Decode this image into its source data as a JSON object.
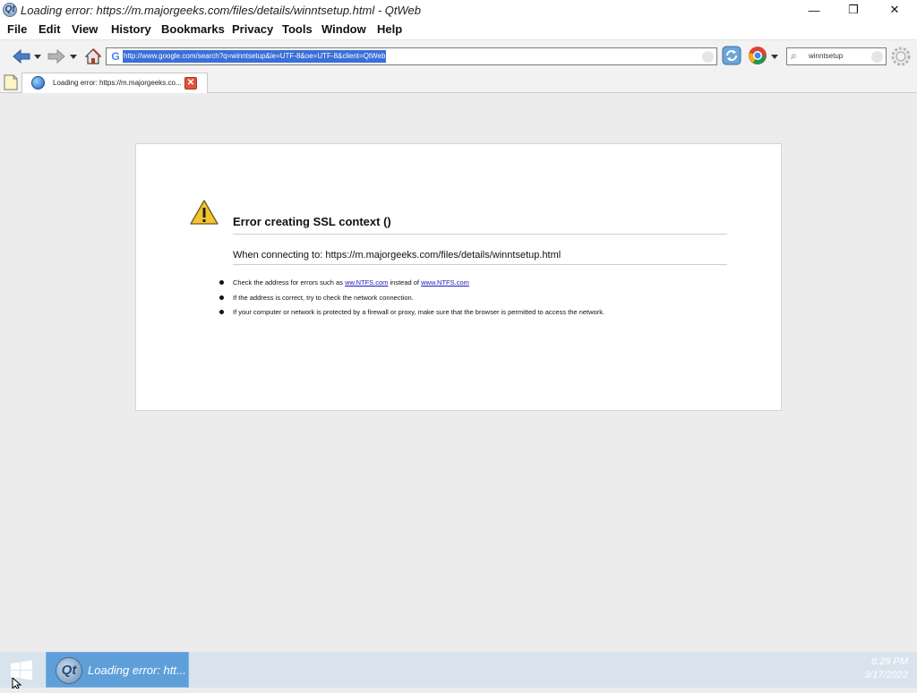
{
  "window": {
    "title": "Loading error: https://m.majorgeeks.com/files/details/winntsetup.html - QtWeb",
    "app_icon_glyph": "Qt",
    "minimize_glyph": "—",
    "maximize_glyph": "❐",
    "close_glyph": "✕"
  },
  "menubar": {
    "items": [
      "File",
      "Edit",
      "View",
      "History",
      "Bookmarks",
      "Privacy",
      "Tools",
      "Window",
      "Help"
    ]
  },
  "toolbar": {
    "url": "http://www.google.com/search?q=winntsetup&ie=UTF-8&oe=UTF-8&client=QtWeb",
    "search_engine_glyph": "G",
    "search_text": "winntsetup"
  },
  "tab": {
    "label": "Loading error: https://m.majorgeeks.co...",
    "close_glyph": "✕"
  },
  "error": {
    "title": "Error creating SSL context ()",
    "connecting": "When connecting to: https://m.majorgeeks.com/files/details/winntsetup.html",
    "tip1_prefix": "Check the address for errors such as ",
    "tip1_link1": "ww.NTFS.com",
    "tip1_middle": " instead of ",
    "tip1_link2": "www.NTFS.com",
    "tip2": "If the address is correct, try to check the network connection.",
    "tip3": "If your computer or network is protected by a firewall or proxy, make sure that the browser is permitted to access the network."
  },
  "taskbar": {
    "task_label": "Loading error: htt...",
    "task_icon_glyph": "Qt",
    "time": "8:29 PM",
    "date": "3/17/2022"
  },
  "colors": {
    "accent": "#3a6fd8",
    "link": "#1a1ab8",
    "taskbar": "#d9e3ee",
    "task_active": "#5e9fd9"
  }
}
